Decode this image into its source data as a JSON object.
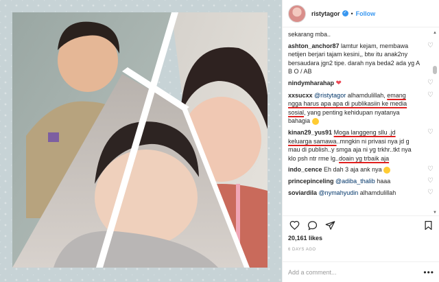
{
  "header": {
    "username": "ristytagor",
    "separator": "•",
    "follow_label": "Follow"
  },
  "comments": [
    {
      "user": "",
      "text": "sekarang mba.."
    },
    {
      "user": "ashton_anchor87",
      "text": "lamtur kejam, membawa netijen berjari tajam kesini,, btw itu anak2ny bersaudara jgn2 tipe. darah nya beda2 ada yg A B O / AB"
    },
    {
      "user": "nindymharahap",
      "text": ""
    },
    {
      "user": "xxsucxx",
      "mention": "@ristytagor",
      "pre": " alhamdulillah, ",
      "ul1": "emang ngga harus apa apa di publikasiin ke media sosial",
      "post": ", yang penting kehidupan nyatanya bahagia"
    },
    {
      "user": "kinan29_yus91",
      "ul1": "Moga langgeng sllu .jd keluarga samawa",
      "mid": "..mngkin ni privasi nya jd g mau di publish..y smga aja ni yg trkhr..tkt nya klo psh ntr rme lg..",
      "ul2": "doain yg trbaik aja"
    },
    {
      "user": "indo_cence",
      "text": "Eh dah 3 aja ank nya"
    },
    {
      "user": "princepinceling",
      "mention": "@adiba_thalib",
      "post": " haaa"
    },
    {
      "user": "soviardila",
      "mention": "@nymahyudin",
      "post": " alhamdulillah"
    }
  ],
  "footer": {
    "likes": "20,161 likes",
    "time_ago": "6 DAYS AGO",
    "comment_placeholder": "Add a comment...",
    "more_label": "•••"
  },
  "icons": {
    "verified": "verified-badge-icon",
    "like": "heart-icon",
    "comment": "speech-bubble-icon",
    "share": "paper-plane-icon",
    "save": "bookmark-icon"
  },
  "colors": {
    "link": "#3897f0",
    "underline": "#e0201f",
    "heart_red": "#ed4956",
    "background": "#c7d3d6"
  }
}
